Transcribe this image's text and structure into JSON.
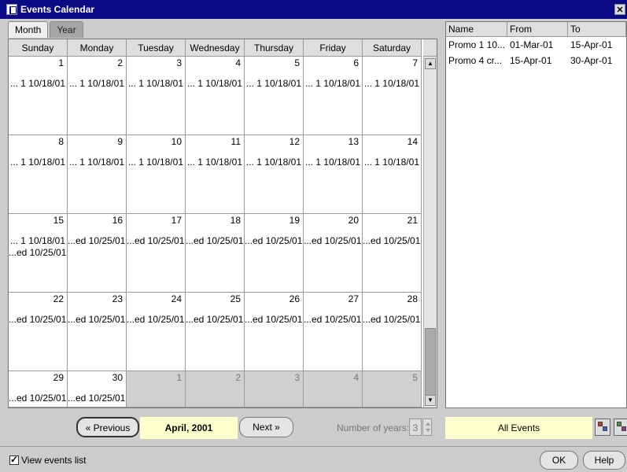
{
  "window": {
    "title": "Events Calendar",
    "close_glyph": "✕"
  },
  "tabs": [
    {
      "label": "Month"
    },
    {
      "label": "Year"
    }
  ],
  "calendar": {
    "weekdays": [
      "Sunday",
      "Monday",
      "Tuesday",
      "Wednesday",
      "Thursday",
      "Friday",
      "Saturday"
    ],
    "weeks": [
      [
        {
          "d": "1",
          "e": [
            "... 1 10/18/01"
          ]
        },
        {
          "d": "2",
          "e": [
            "... 1 10/18/01"
          ]
        },
        {
          "d": "3",
          "e": [
            "... 1 10/18/01"
          ]
        },
        {
          "d": "4",
          "e": [
            "... 1 10/18/01"
          ]
        },
        {
          "d": "5",
          "e": [
            "... 1 10/18/01"
          ]
        },
        {
          "d": "6",
          "e": [
            "... 1 10/18/01"
          ]
        },
        {
          "d": "7",
          "e": [
            "... 1 10/18/01"
          ]
        }
      ],
      [
        {
          "d": "8",
          "e": [
            "... 1 10/18/01"
          ]
        },
        {
          "d": "9",
          "e": [
            "... 1 10/18/01"
          ]
        },
        {
          "d": "10",
          "e": [
            "... 1 10/18/01"
          ]
        },
        {
          "d": "11",
          "e": [
            "... 1 10/18/01"
          ]
        },
        {
          "d": "12",
          "e": [
            "... 1 10/18/01"
          ]
        },
        {
          "d": "13",
          "e": [
            "... 1 10/18/01"
          ]
        },
        {
          "d": "14",
          "e": [
            "... 1 10/18/01"
          ]
        }
      ],
      [
        {
          "d": "15",
          "e": [
            "... 1 10/18/01",
            "...ed 10/25/01"
          ]
        },
        {
          "d": "16",
          "e": [
            "...ed 10/25/01"
          ]
        },
        {
          "d": "17",
          "e": [
            "...ed 10/25/01"
          ]
        },
        {
          "d": "18",
          "e": [
            "...ed 10/25/01"
          ]
        },
        {
          "d": "19",
          "e": [
            "...ed 10/25/01"
          ]
        },
        {
          "d": "20",
          "e": [
            "...ed 10/25/01"
          ]
        },
        {
          "d": "21",
          "e": [
            "...ed 10/25/01"
          ]
        }
      ],
      [
        {
          "d": "22",
          "e": [
            "...ed 10/25/01"
          ]
        },
        {
          "d": "23",
          "e": [
            "...ed 10/25/01"
          ]
        },
        {
          "d": "24",
          "e": [
            "...ed 10/25/01"
          ]
        },
        {
          "d": "25",
          "e": [
            "...ed 10/25/01"
          ]
        },
        {
          "d": "26",
          "e": [
            "...ed 10/25/01"
          ]
        },
        {
          "d": "27",
          "e": [
            "...ed 10/25/01"
          ]
        },
        {
          "d": "28",
          "e": [
            "...ed 10/25/01"
          ]
        }
      ],
      [
        {
          "d": "29",
          "e": [
            "...ed 10/25/01"
          ]
        },
        {
          "d": "30",
          "e": [
            "...ed 10/25/01"
          ]
        },
        {
          "d": "1",
          "other": true,
          "e": []
        },
        {
          "d": "2",
          "other": true,
          "e": []
        },
        {
          "d": "3",
          "other": true,
          "e": []
        },
        {
          "d": "4",
          "other": true,
          "e": []
        },
        {
          "d": "5",
          "other": true,
          "e": []
        }
      ]
    ]
  },
  "events_list": {
    "columns": [
      "Name",
      "From",
      "To"
    ],
    "rows": [
      [
        "Promo 1 10...",
        "01-Mar-01",
        "15-Apr-01"
      ],
      [
        "Promo 4 cr...",
        "15-Apr-01",
        "30-Apr-01"
      ]
    ]
  },
  "nav": {
    "previous_label": "Previous",
    "previous_glyph": "«",
    "month_label": "April, 2001",
    "next_label": "Next",
    "next_glyph": "»",
    "years_label": "Number of years:",
    "years_value": "3",
    "filter_label": "All Events"
  },
  "footer": {
    "view_events_label": "View events list",
    "view_events_checked": true,
    "ok_label": "OK",
    "help_label": "Help"
  }
}
